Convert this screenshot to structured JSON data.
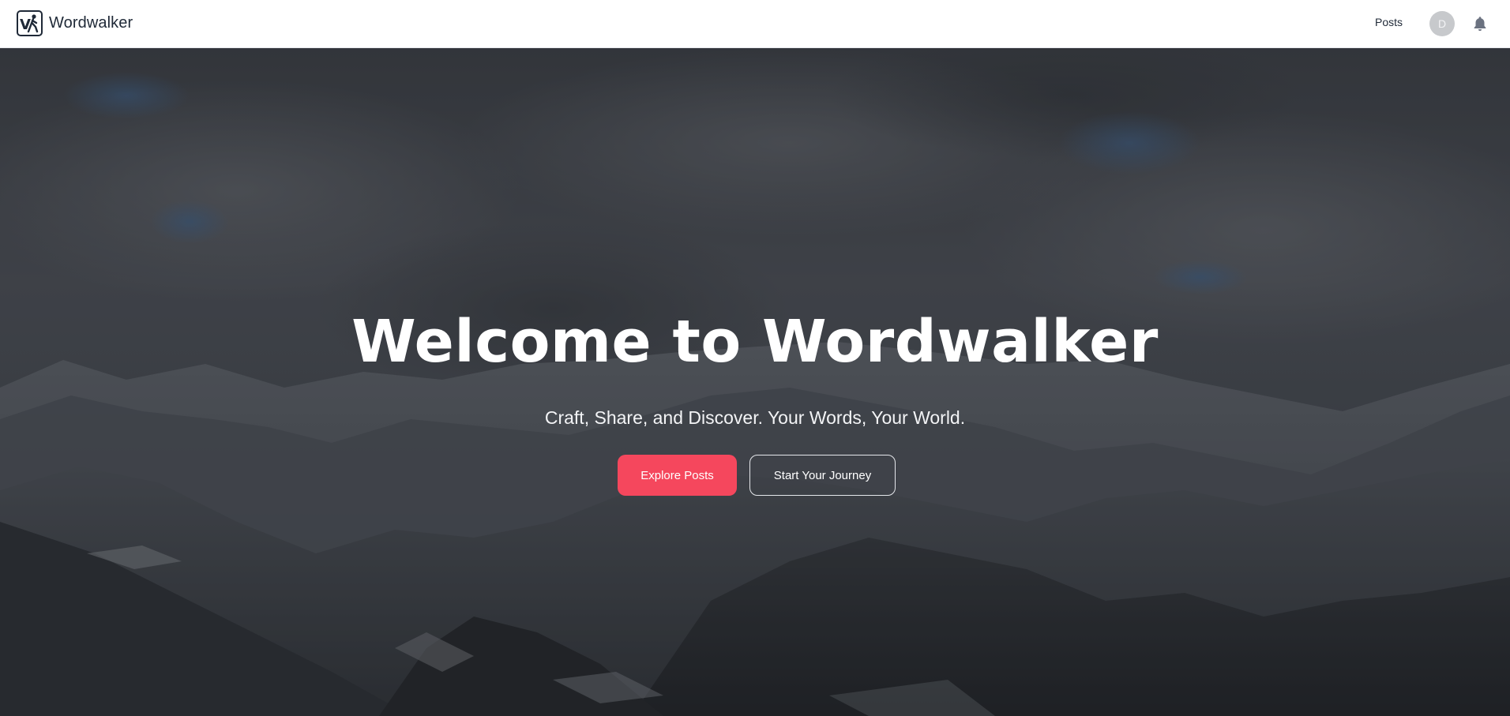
{
  "navbar": {
    "brand_name": "Wordwalker",
    "logo_icon": "walker-logo-icon",
    "links": [
      {
        "label": "Posts"
      }
    ],
    "avatar_initial": "D",
    "notification_icon": "bell-icon"
  },
  "hero": {
    "title": "Welcome to Wordwalker",
    "subtitle": "Craft, Share, and Discover. Your Words, Your World.",
    "primary_button": "Explore Posts",
    "secondary_button": "Start Your Journey",
    "background": "mountain-landscape-image"
  },
  "colors": {
    "accent": "#f5475d",
    "navbar_bg": "#ffffff",
    "text_dark": "#1f2937",
    "avatar_bg": "#c7c9cc"
  }
}
